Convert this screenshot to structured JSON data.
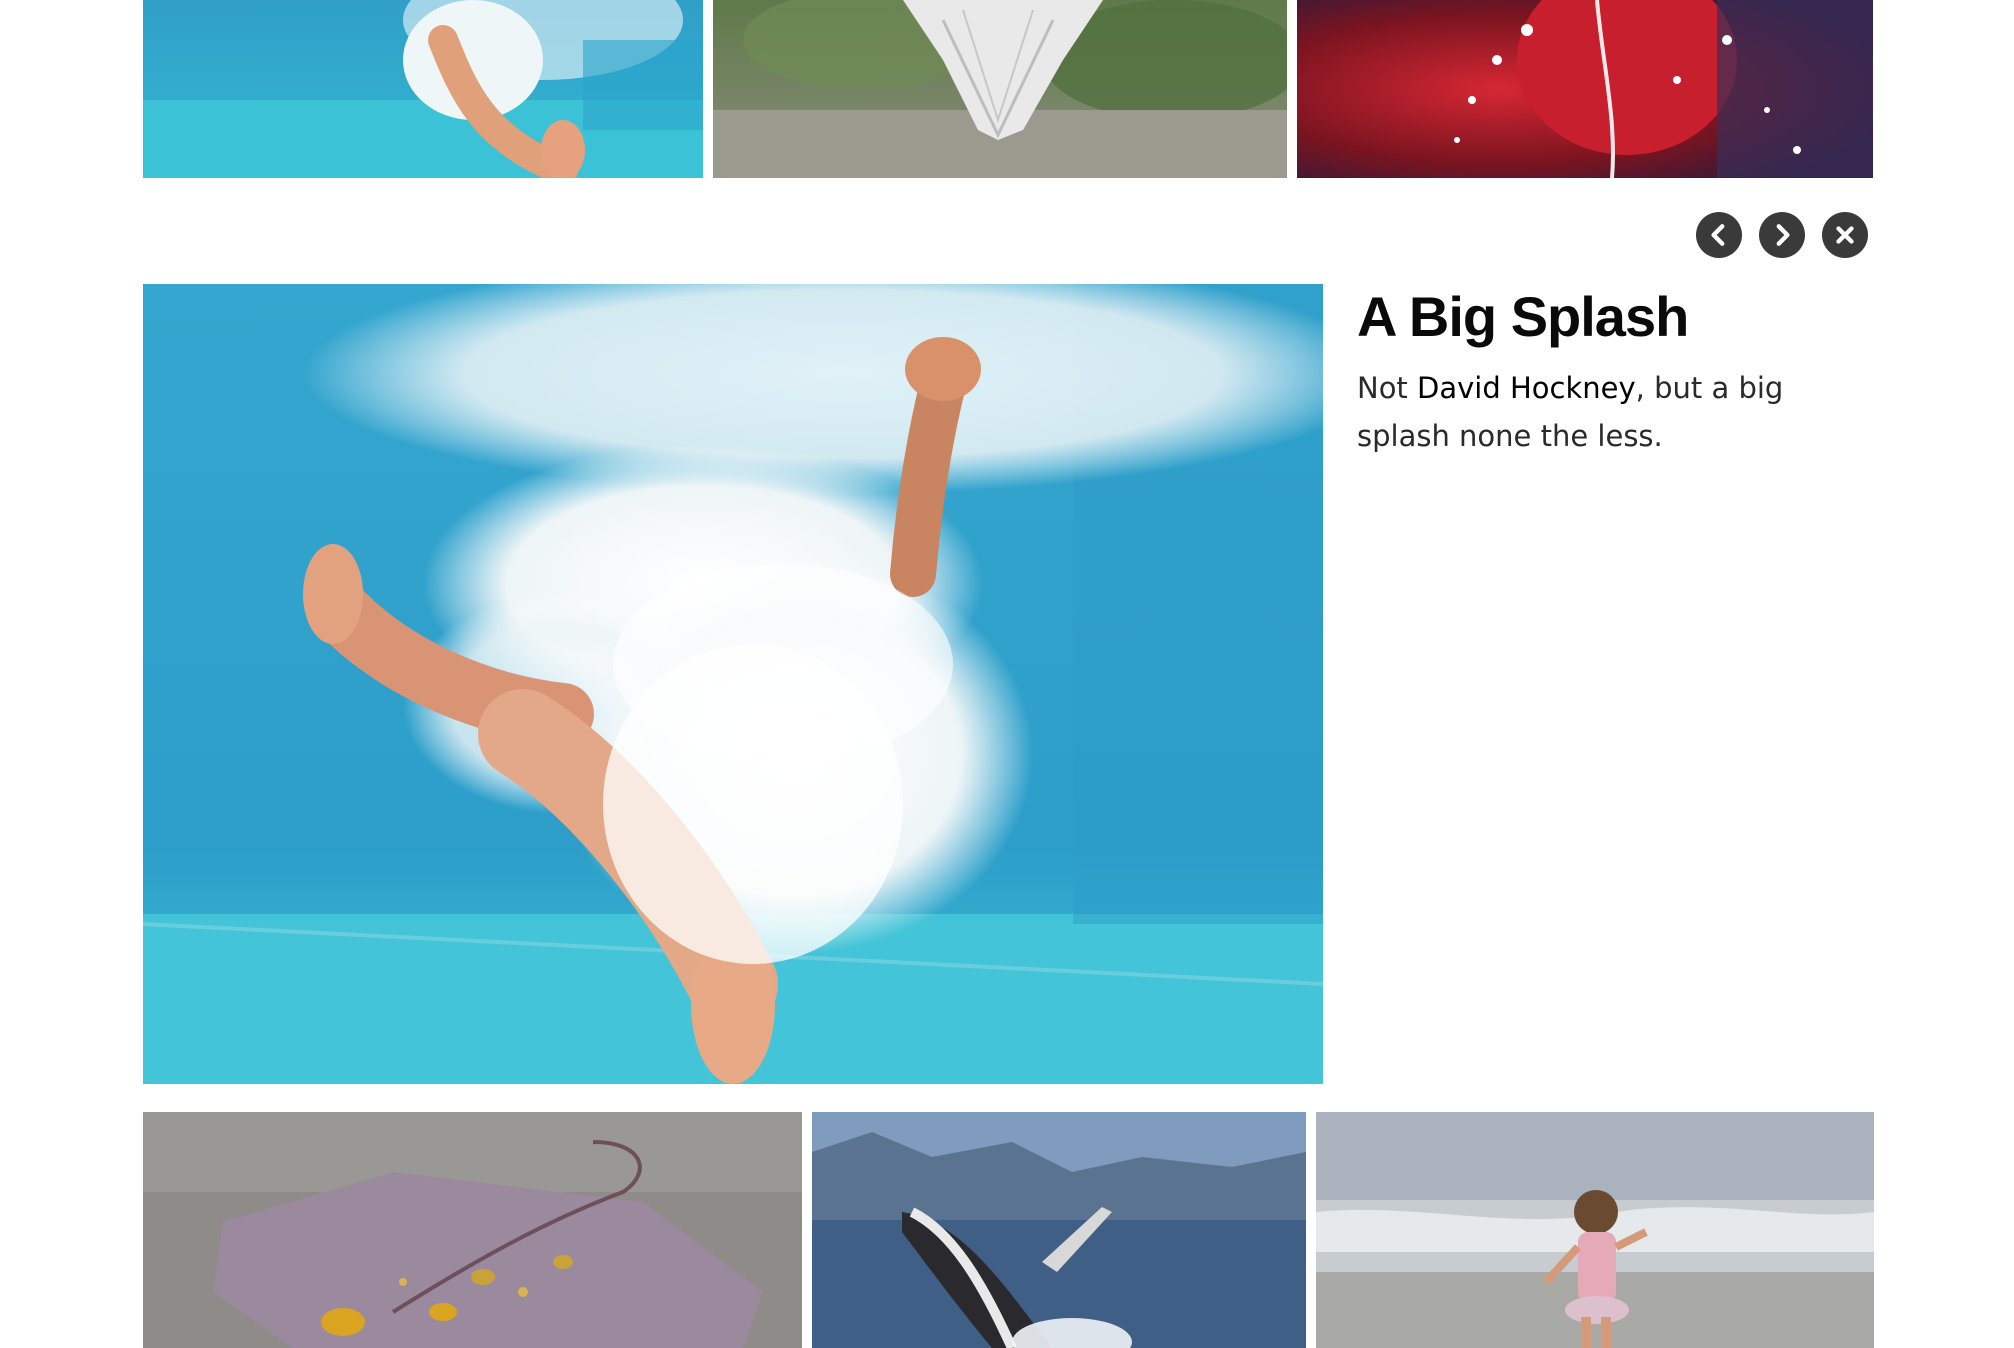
{
  "gallery": {
    "top_row": [
      {
        "name": "swimmer-thumb"
      },
      {
        "name": "reflection-thumb"
      },
      {
        "name": "red-splash-thumb"
      }
    ],
    "bottom_row": [
      {
        "name": "leaf-thumb"
      },
      {
        "name": "whale-thumb"
      },
      {
        "name": "girl-beach-thumb"
      }
    ]
  },
  "lightbox": {
    "controls": {
      "prev_icon": "chevron-left-icon",
      "next_icon": "chevron-right-icon",
      "close_icon": "close-icon"
    },
    "title": "A Big Splash",
    "description_pre": "Not ",
    "description_em": "David Hockney",
    "description_post": ", but a big splash none the less."
  },
  "colors": {
    "control_bg": "#3a3a3a",
    "pool_blue": "#2aa9d0",
    "text": "#111111"
  }
}
